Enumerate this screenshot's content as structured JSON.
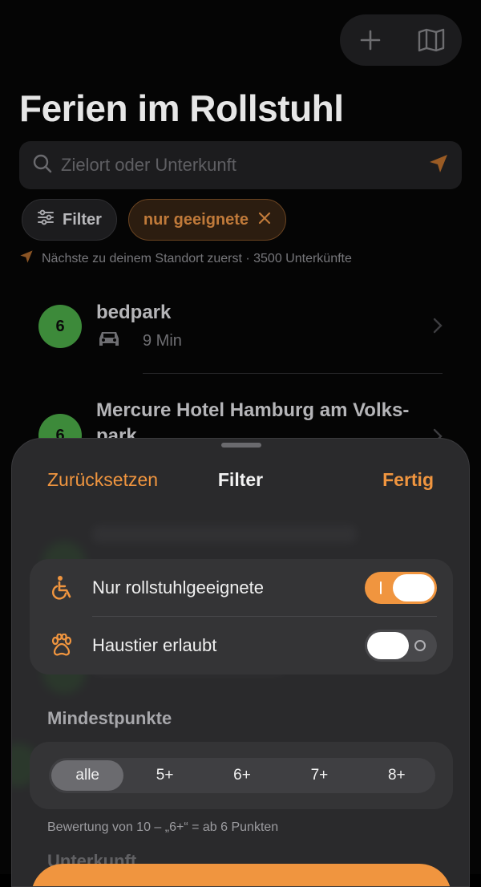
{
  "header": {
    "title": "Ferien im Rollstuhl"
  },
  "search": {
    "placeholder": "Zielort oder Unterkunft"
  },
  "chips": {
    "filter_label": "Filter",
    "active_label": "nur geeignete"
  },
  "location_hint": "Nächste zu deinem Standort zuerst · 3500 Unterkünfte",
  "list": [
    {
      "score": "6",
      "title": "bedpark",
      "duration": "9 Min"
    },
    {
      "score": "6",
      "title": "Mercure Hotel Hamburg am Volks-",
      "title_line2": "park"
    }
  ],
  "sheet": {
    "reset_label": "Zurücksetzen",
    "title": "Filter",
    "done_label": "Fertig",
    "toggles": [
      {
        "label": "Nur rollstuhlgeeignete",
        "icon": "wheelchair-icon",
        "on": true
      },
      {
        "label": "Haustier erlaubt",
        "icon": "paw-icon",
        "on": false
      }
    ],
    "min_points_label": "Mindestpunkte",
    "min_points_options": [
      "alle",
      "5+",
      "6+",
      "7+",
      "8+"
    ],
    "min_points_selected": "alle",
    "min_points_hint": "Bewertung von 10 – „6+“ = ab 6 Punkten",
    "next_section_label": "Unterkunft"
  },
  "colors": {
    "accent": "#f0953f",
    "score_green": "#3d8a3a",
    "sheet_bg": "#2a2a2c"
  }
}
